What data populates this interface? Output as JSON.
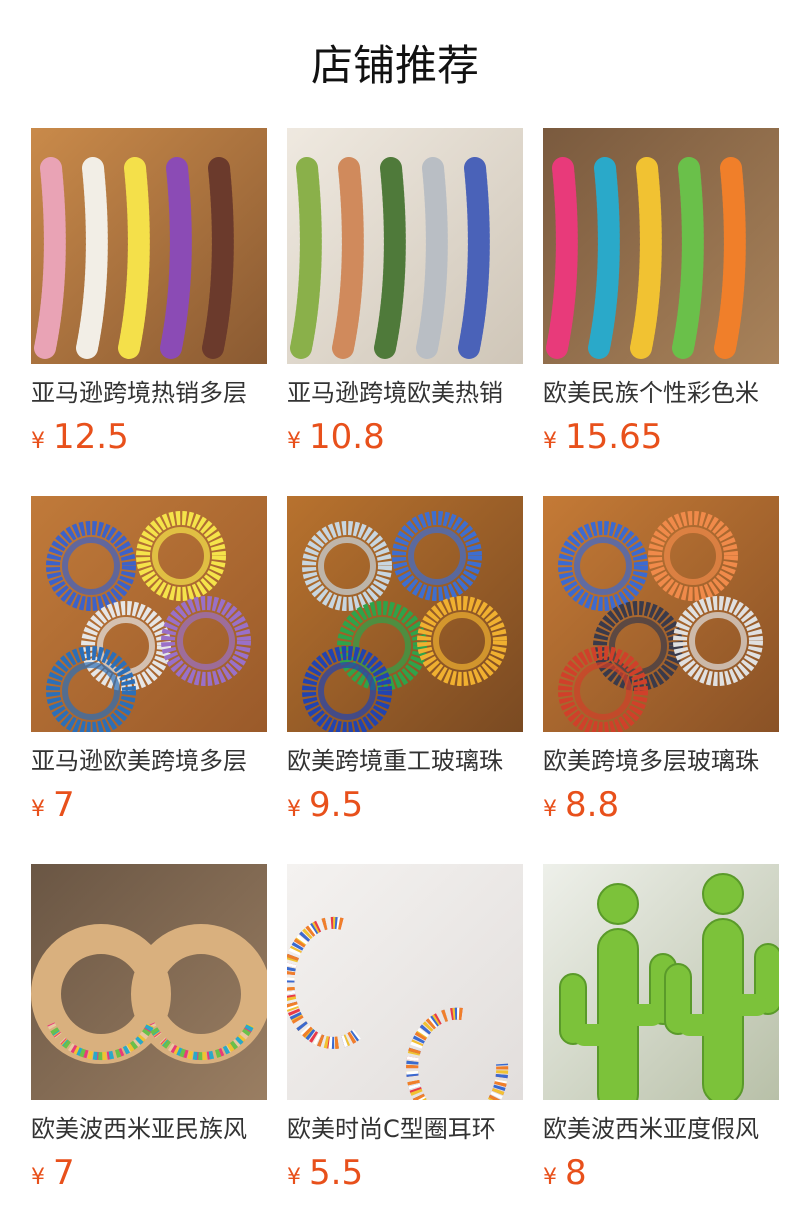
{
  "page": {
    "title": "店铺推荐"
  },
  "theme": {
    "price_color": "#e8501b",
    "title_color": "#111111",
    "name_color": "#333333"
  },
  "currency_symbol": "¥",
  "products": [
    {
      "name": "亚马逊跨境热销多层",
      "price": "12.5",
      "image": "layered-seed-bead-necklaces-photo",
      "palette": [
        "#e9a3b5",
        "#f2eee6",
        "#f4e04a",
        "#8b4bb5",
        "#6b3a2c"
      ]
    },
    {
      "name": "亚马逊跨境欧美热销",
      "price": "10.8",
      "image": "green-and-blue-bead-necklaces-with-hat-photo",
      "palette": [
        "#8ab04a",
        "#d08a5c",
        "#4f7a3a",
        "#b9bec4",
        "#4a62b8"
      ]
    },
    {
      "name": "欧美民族个性彩色米",
      "price": "15.65",
      "image": "colorful-seed-bead-necklace-photo",
      "palette": [
        "#e83a7a",
        "#2aa9c9",
        "#f1c232",
        "#6ac04a",
        "#f07f2a"
      ]
    },
    {
      "name": "亚马逊欧美跨境多层",
      "price": "7",
      "image": "wrap-bracelets-on-table-photo",
      "palette": [
        "#3d62c8",
        "#f5e34a",
        "#e6e6e6",
        "#9a70c8",
        "#2c6fb8"
      ]
    },
    {
      "name": "欧美跨境重工玻璃珠",
      "price": "9.5",
      "image": "glass-bead-bracelets-on-table-photo",
      "palette": [
        "#c8d6e0",
        "#3e6ed0",
        "#2fa34a",
        "#f0b030",
        "#2244b0"
      ]
    },
    {
      "name": "欧美跨境多层玻璃珠",
      "price": "8.8",
      "image": "multilayer-glass-bead-bracelets-photo",
      "palette": [
        "#3c6ad0",
        "#f08a4a",
        "#3a3a4a",
        "#e0e0e0",
        "#d0402a"
      ]
    },
    {
      "name": "欧美波西米亚民族风",
      "price": "7",
      "image": "bohemian-hoop-earrings-on-wood-photo",
      "palette": [
        "#e8c8a0",
        "#e83a7a",
        "#f1c232",
        "#2aa9c9",
        "#6ac04a"
      ]
    },
    {
      "name": "欧美时尚C型圈耳环",
      "price": "5.5",
      "image": "c-hoop-bead-earrings-photo",
      "palette": [
        "#e83a4a",
        "#f1c232",
        "#3a6ad0",
        "#ffffff",
        "#f07f2a"
      ]
    },
    {
      "name": "欧美波西米亚度假风",
      "price": "8",
      "image": "green-cactus-bead-earrings-photo",
      "palette": [
        "#7cc23a",
        "#5a9a2a",
        "#e8e8e0",
        "#a8b098",
        "#c8a8b0"
      ]
    }
  ]
}
